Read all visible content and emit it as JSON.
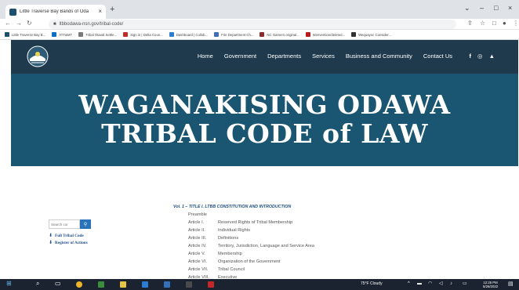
{
  "browser": {
    "tab_title": "Little Traverse Bay Bands of Oda",
    "tab_close": "×",
    "new_tab": "+",
    "window_controls": [
      "⌄",
      "–",
      "□",
      "×"
    ],
    "url": "ltbbodawa-nsn.gov/tribal-code/",
    "bookmarks": [
      {
        "label": "Little Traverse Bay B...",
        "color": "#1d4f6e"
      },
      {
        "label": "ATT&MT",
        "color": "#0a6fc2"
      },
      {
        "label": "Tribal Otaval Settle...",
        "color": "#7a7a7a"
      },
      {
        "label": "Sign in | Delta Coun...",
        "color": "#c62828"
      },
      {
        "label": "Dashboard | Collob...",
        "color": "#2e7dd1"
      },
      {
        "label": "Fire Department Ch...",
        "color": "#3f6fb5"
      },
      {
        "label": "NC Gamers original...",
        "color": "#8d2b2b"
      },
      {
        "label": "Intervention/deleted...",
        "color": "#b71c1c"
      },
      {
        "label": "Wequayoc Consider...",
        "color": "#333333"
      }
    ]
  },
  "site": {
    "menu": [
      "Home",
      "Government",
      "Departments",
      "Services",
      "Business and Community",
      "Contact Us"
    ],
    "social": [
      "f",
      "◎",
      "▲"
    ],
    "banner_line1": "WAGANAKISING ODAWA",
    "banner_line2": "TRIBAL CODE of LAW"
  },
  "sidebar": {
    "search_placeholder": "Search cor",
    "links": [
      "Full Tribal Code",
      "Register of Actions"
    ]
  },
  "toc": {
    "volume_title": "Vol. 1 – TITLE I. LTBB CONSTITUTION AND INTRODUCTION",
    "preamble": "Preamble",
    "articles": [
      {
        "num": "Article I.",
        "title": "Reserved Rights of Tribal Membership"
      },
      {
        "num": "Article II.",
        "title": "Individual Rights"
      },
      {
        "num": "Article III.",
        "title": "Definitions"
      },
      {
        "num": "Article IV.",
        "title": "Territory, Jurisdiction, Language and Service Area"
      },
      {
        "num": "Article V.",
        "title": "Membership"
      },
      {
        "num": "Article VI.",
        "title": "Organization of the Government"
      },
      {
        "num": "Article VII.",
        "title": "Tribal Council"
      },
      {
        "num": "Article VIII.",
        "title": "Executive"
      }
    ]
  },
  "taskbar": {
    "weather": "75°F Cloudy",
    "time": "12:25 PM",
    "date": "5/26/2022"
  },
  "colors": {
    "nav_bg": "#1e3a4c",
    "banner_bg": "#1a5671",
    "link": "#1e4f8a",
    "accent": "#2a73b8"
  }
}
